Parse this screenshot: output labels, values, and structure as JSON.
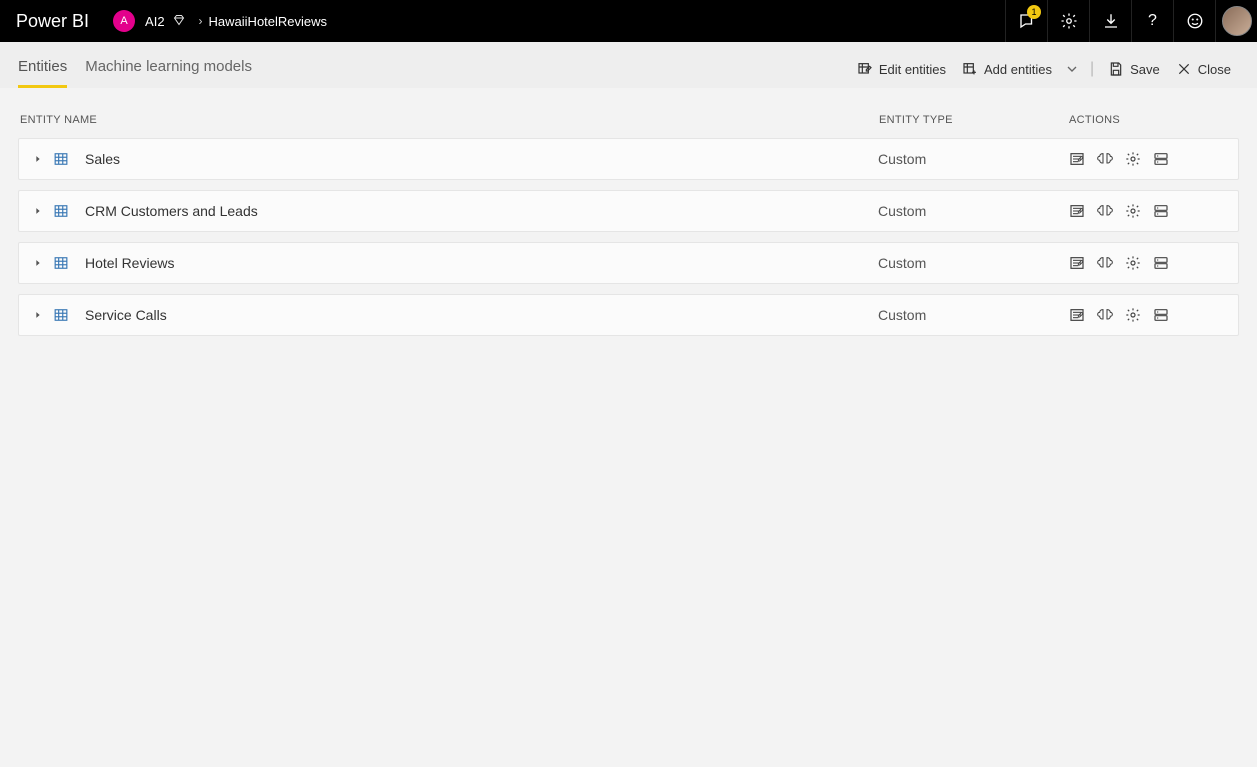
{
  "header": {
    "brand": "Power BI",
    "workspace_initial": "A",
    "workspace_name": "AI2",
    "breadcrumb": "HawaiiHotelReviews",
    "notif_count": "1"
  },
  "tabs": [
    {
      "label": "Entities",
      "active": true
    },
    {
      "label": "Machine learning models",
      "active": false
    }
  ],
  "commands": {
    "edit": "Edit entities",
    "add": "Add entities",
    "save": "Save",
    "close": "Close"
  },
  "columns": {
    "name": "Entity Name",
    "type": "Entity Type",
    "actions": "Actions"
  },
  "entities": [
    {
      "name": "Sales",
      "type": "Custom"
    },
    {
      "name": "CRM Customers and Leads",
      "type": "Custom"
    },
    {
      "name": "Hotel Reviews",
      "type": "Custom"
    },
    {
      "name": "Service Calls",
      "type": "Custom"
    }
  ]
}
